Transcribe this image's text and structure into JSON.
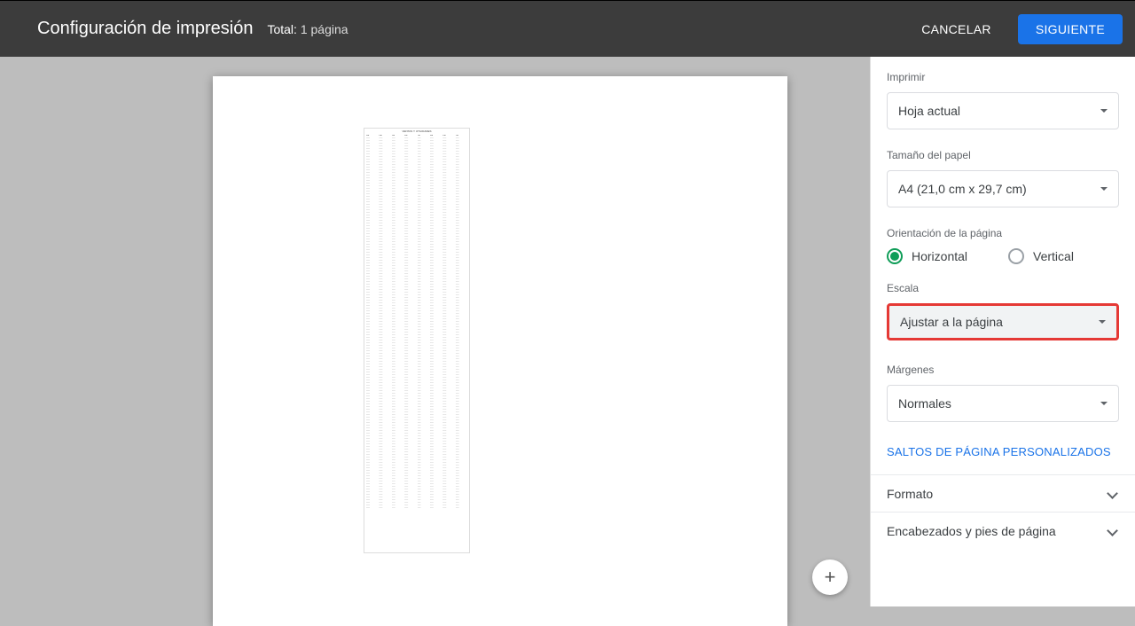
{
  "header": {
    "title": "Configuración de impresión",
    "total_label": "Total:",
    "total_value": "1 página",
    "cancel_label": "CANCELAR",
    "next_label": "SIGUIENTE"
  },
  "side": {
    "print_label": "Imprimir",
    "print_value": "Hoja actual",
    "paper_label": "Tamaño del papel",
    "paper_value": "A4 (21,0 cm x 29,7 cm)",
    "orientation_label": "Orientación de la página",
    "orientation_horizontal": "Horizontal",
    "orientation_vertical": "Vertical",
    "scale_label": "Escala",
    "scale_value": "Ajustar a la página",
    "margins_label": "Márgenes",
    "margins_value": "Normales",
    "page_breaks": "SALTOS DE PÁGINA PERSONALIZADOS",
    "accordion_format": "Formato",
    "accordion_headers": "Encabezados y pies de página"
  },
  "fab": {
    "icon": "+"
  },
  "preview": {
    "title": "VENTAS Y UTILIDADES"
  }
}
